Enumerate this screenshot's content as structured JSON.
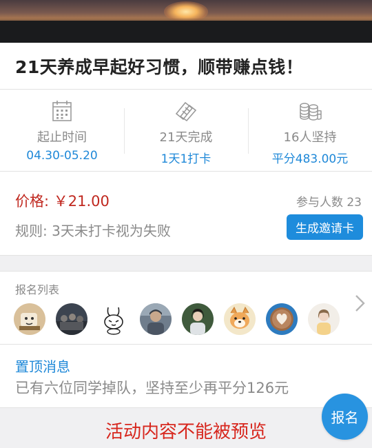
{
  "title": "21天养成早起好习惯，顺带赚点钱！",
  "stats": [
    {
      "icon": "calendar-icon",
      "label": "起止时间",
      "value": "04.30-05.20"
    },
    {
      "icon": "tickets-icon",
      "label": "21天完成",
      "value": "1天1打卡"
    },
    {
      "icon": "coins-icon",
      "label": "16人坚持",
      "value": "平分483.00元"
    }
  ],
  "price": {
    "text": "价格: ￥21.00",
    "color": "#c0281f"
  },
  "participants": "参与人数 23",
  "rule": "规则: 3天未打卡视为失败",
  "invite_button": "生成邀请卡",
  "enroll": {
    "title": "报名列表",
    "avatars": [
      "avatar-cartoon-bread",
      "avatar-group-photo",
      "avatar-rabbit-sketch",
      "avatar-person-outdoor",
      "avatar-girl-portrait",
      "avatar-shiba-dog",
      "avatar-latte-art",
      "avatar-girl-light"
    ]
  },
  "pinned": {
    "title": "置顶消息",
    "text": "已有六位同学掉队，坚持至少再平分126元"
  },
  "notice": "活动内容不能被预览",
  "signup_button": "报名",
  "colors": {
    "accent": "#1e88d8",
    "price": "#c0281f",
    "notice": "#d7261d",
    "button": "#1e8cdc"
  }
}
